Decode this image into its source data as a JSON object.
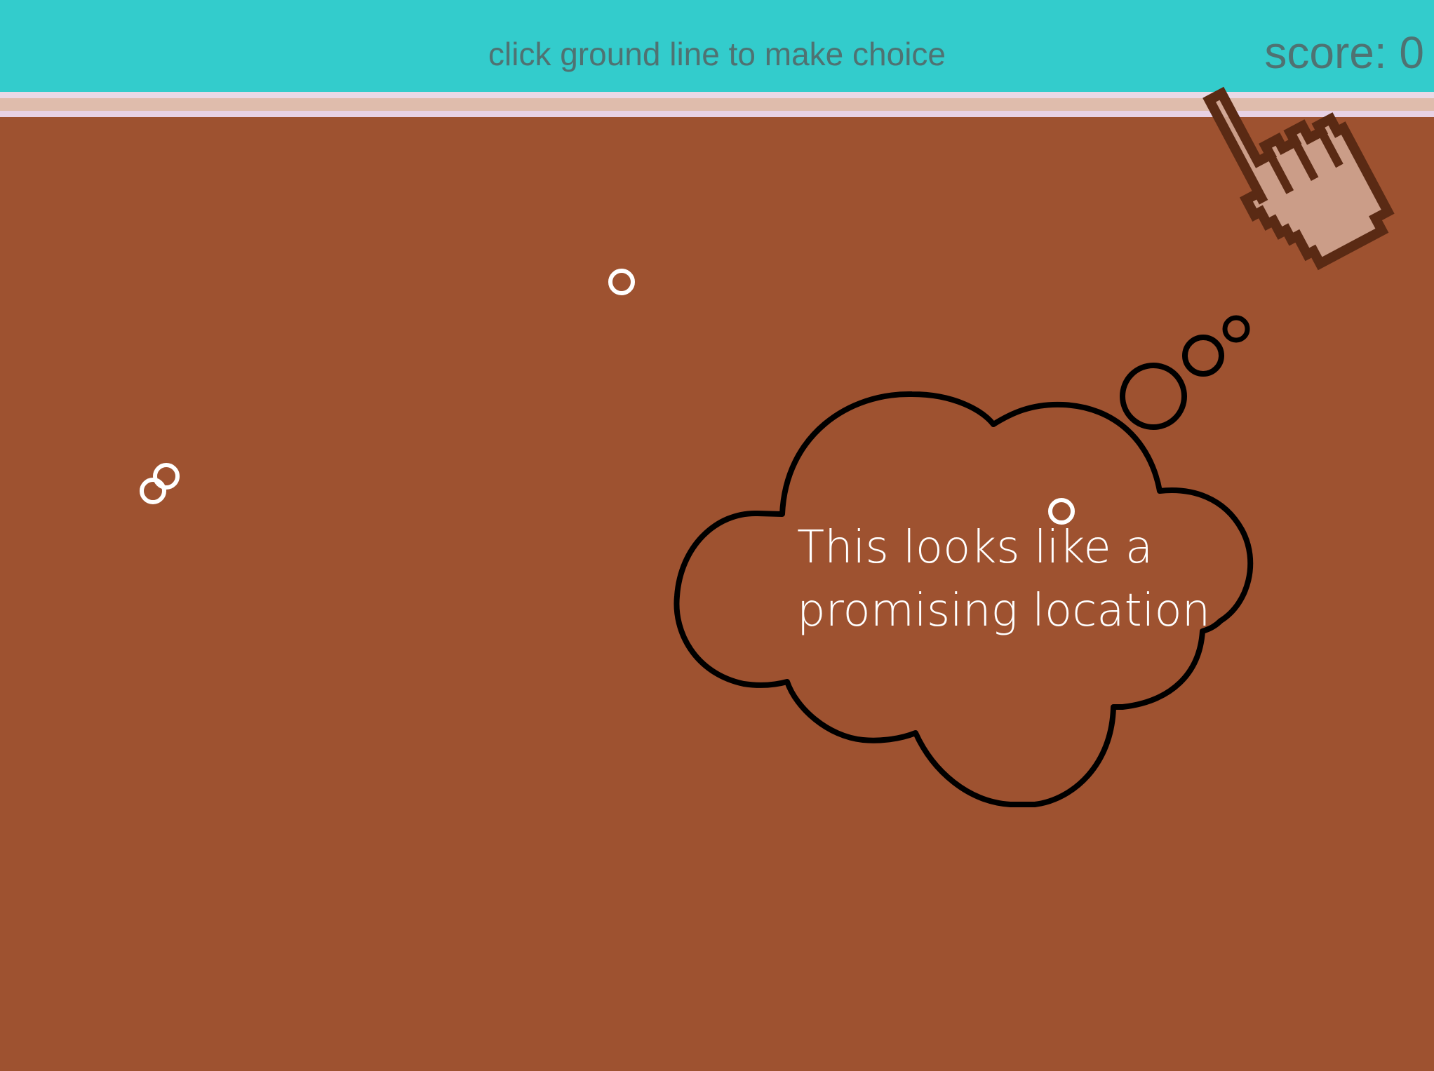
{
  "header": {
    "instruction": "click ground line to make choice",
    "score_label": "score: 0"
  },
  "thought_bubble": {
    "line1": "This looks like a",
    "line2": "promising location"
  },
  "cursor": {
    "icon": "pointing-hand-icon"
  },
  "colors": {
    "sky": "#33cccc",
    "dirt": "#9e5230",
    "header_text": "#4f7272",
    "ground_stripe_light": "#e9d9e6",
    "ground_stripe_mid": "#dfbcac",
    "marker": "#ffffff",
    "cloud_outline": "#000000",
    "hand_fill": "#cfa490",
    "hand_outline": "#5a2a14"
  }
}
